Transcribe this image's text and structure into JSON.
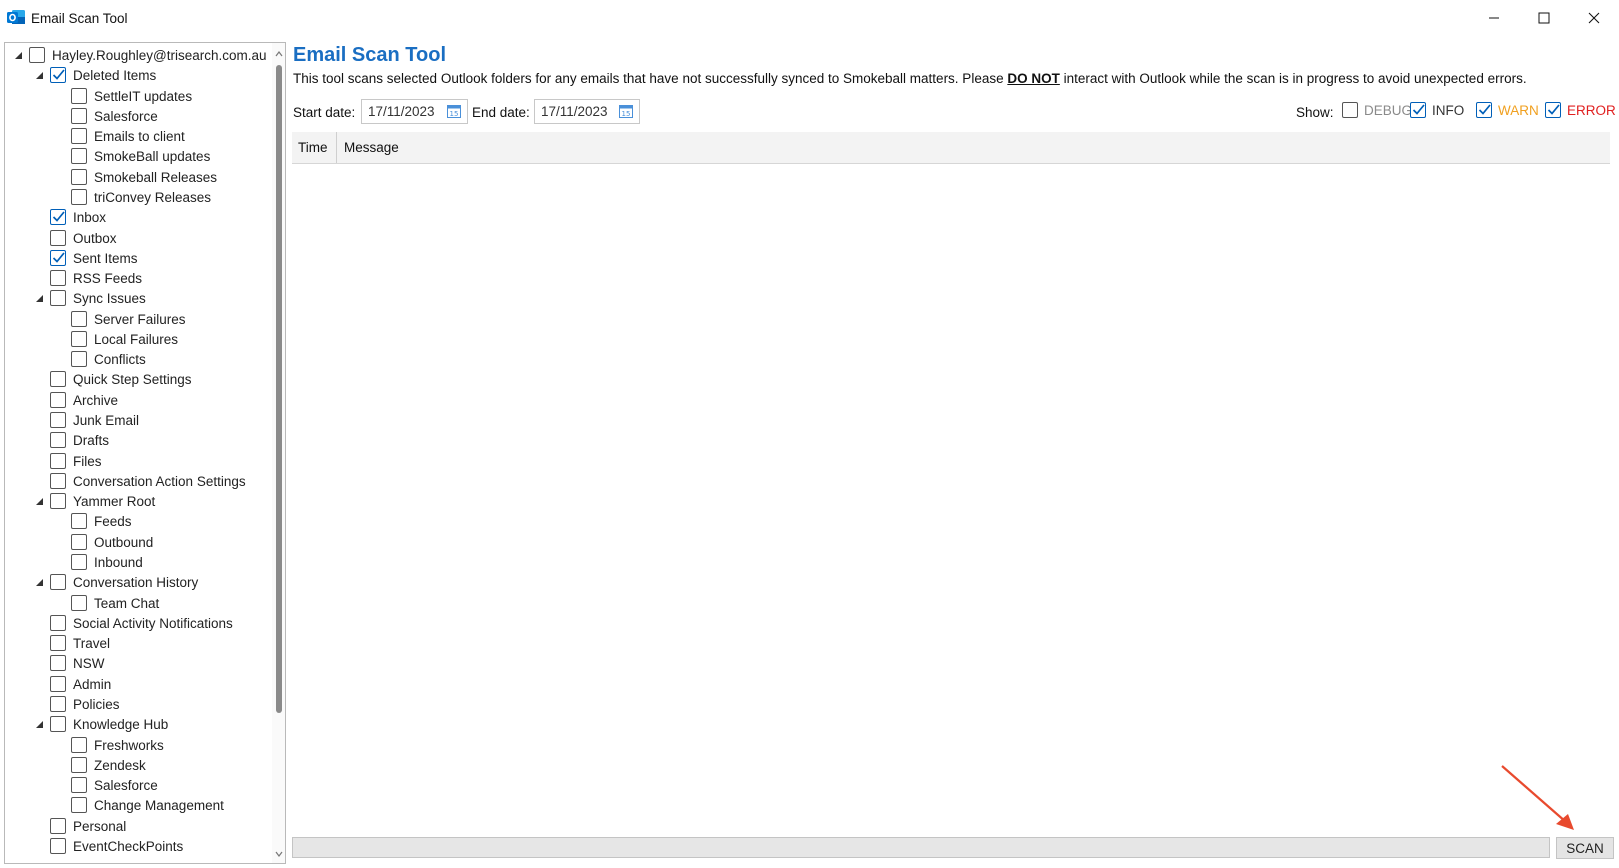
{
  "window": {
    "title": "Email Scan Tool"
  },
  "tree": {
    "nodes": [
      {
        "label": "Hayley.Roughley@trisearch.com.au",
        "level": 0,
        "checked": false,
        "expanded": true
      },
      {
        "label": "Deleted Items",
        "level": 1,
        "checked": true,
        "expanded": true
      },
      {
        "label": "SettleIT updates",
        "level": 2,
        "checked": false
      },
      {
        "label": "Salesforce",
        "level": 2,
        "checked": false
      },
      {
        "label": "Emails to client",
        "level": 2,
        "checked": false
      },
      {
        "label": "SmokeBall updates",
        "level": 2,
        "checked": false
      },
      {
        "label": "Smokeball Releases",
        "level": 2,
        "checked": false
      },
      {
        "label": "triConvey Releases",
        "level": 2,
        "checked": false
      },
      {
        "label": "Inbox",
        "level": 1,
        "checked": true
      },
      {
        "label": "Outbox",
        "level": 1,
        "checked": false
      },
      {
        "label": "Sent Items",
        "level": 1,
        "checked": true
      },
      {
        "label": "RSS Feeds",
        "level": 1,
        "checked": false
      },
      {
        "label": "Sync Issues",
        "level": 1,
        "checked": false,
        "expanded": true
      },
      {
        "label": "Server Failures",
        "level": 2,
        "checked": false
      },
      {
        "label": "Local Failures",
        "level": 2,
        "checked": false
      },
      {
        "label": "Conflicts",
        "level": 2,
        "checked": false
      },
      {
        "label": "Quick Step Settings",
        "level": 1,
        "checked": false
      },
      {
        "label": "Archive",
        "level": 1,
        "checked": false
      },
      {
        "label": "Junk Email",
        "level": 1,
        "checked": false
      },
      {
        "label": "Drafts",
        "level": 1,
        "checked": false
      },
      {
        "label": "Files",
        "level": 1,
        "checked": false
      },
      {
        "label": "Conversation Action Settings",
        "level": 1,
        "checked": false
      },
      {
        "label": "Yammer Root",
        "level": 1,
        "checked": false,
        "expanded": true
      },
      {
        "label": "Feeds",
        "level": 2,
        "checked": false
      },
      {
        "label": "Outbound",
        "level": 2,
        "checked": false
      },
      {
        "label": "Inbound",
        "level": 2,
        "checked": false
      },
      {
        "label": "Conversation History",
        "level": 1,
        "checked": false,
        "expanded": true
      },
      {
        "label": "Team Chat",
        "level": 2,
        "checked": false
      },
      {
        "label": "Social Activity Notifications",
        "level": 1,
        "checked": false
      },
      {
        "label": "Travel",
        "level": 1,
        "checked": false
      },
      {
        "label": "NSW",
        "level": 1,
        "checked": false
      },
      {
        "label": "Admin",
        "level": 1,
        "checked": false
      },
      {
        "label": "Policies",
        "level": 1,
        "checked": false
      },
      {
        "label": "Knowledge Hub",
        "level": 1,
        "checked": false,
        "expanded": true
      },
      {
        "label": "Freshworks",
        "level": 2,
        "checked": false
      },
      {
        "label": "Zendesk",
        "level": 2,
        "checked": false
      },
      {
        "label": "Salesforce",
        "level": 2,
        "checked": false
      },
      {
        "label": "Change Management",
        "level": 2,
        "checked": false
      },
      {
        "label": "Personal",
        "level": 1,
        "checked": false
      },
      {
        "label": "EventCheckPoints",
        "level": 1,
        "checked": false
      }
    ]
  },
  "main": {
    "title": "Email Scan Tool",
    "description_pre": "This tool scans selected Outlook folders for any emails that have not successfully synced to Smokeball matters. Please ",
    "description_strong": "DO NOT",
    "description_post": " interact with Outlook while the scan is in progress to avoid unexpected errors.",
    "start_date_label": "Start date:",
    "start_date_value": "17/11/2023",
    "end_date_label": "End date:",
    "end_date_value": "17/11/2023",
    "show_label": "Show:",
    "filters": [
      {
        "label": "DEBUG",
        "checked": false,
        "color": "#8a8a8a"
      },
      {
        "label": "INFO",
        "checked": true,
        "color": "#333333"
      },
      {
        "label": "WARN",
        "checked": true,
        "color": "#f0a020"
      },
      {
        "label": "ERROR",
        "checked": true,
        "color": "#e02020"
      }
    ],
    "columns": {
      "time": "Time",
      "message": "Message"
    },
    "progress": 0,
    "scan_button": "SCAN"
  },
  "colors": {
    "accent": "#1a6ec2",
    "arrow": "#e84a2e"
  }
}
